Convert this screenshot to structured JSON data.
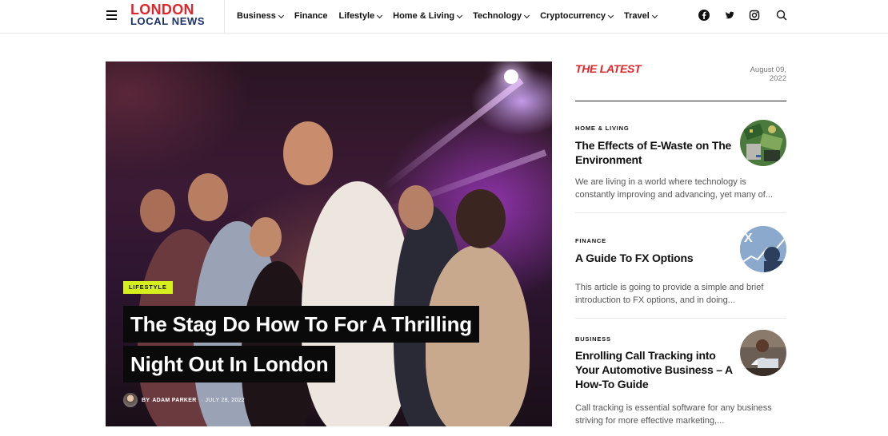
{
  "header": {
    "logo_top": "LONDON",
    "logo_bottom": "LOCAL NEWS",
    "nav": [
      {
        "label": "Business",
        "has_dropdown": true
      },
      {
        "label": "Finance",
        "has_dropdown": false
      },
      {
        "label": "Lifestyle",
        "has_dropdown": true
      },
      {
        "label": "Home & Living",
        "has_dropdown": true
      },
      {
        "label": "Technology",
        "has_dropdown": true
      },
      {
        "label": "Cryptocurrency",
        "has_dropdown": true
      },
      {
        "label": "Travel",
        "has_dropdown": true
      }
    ],
    "social_icons": [
      "facebook-icon",
      "twitter-icon",
      "instagram-icon"
    ],
    "search_icon": "search-icon",
    "menu_icon": "hamburger-menu-icon"
  },
  "hero": {
    "category": "LIFESTYLE",
    "title_line1": "The Stag Do How To For A Thrilling",
    "title_line2": "Night Out In London",
    "by": "BY",
    "author": "ADAM PARKER",
    "date": "JULY 28, 2022"
  },
  "latest": {
    "heading": "THE LATEST",
    "date": "August 09, 2022",
    "posts": [
      {
        "category": "HOME & LIVING",
        "title": "The Effects of E-Waste on The Environment",
        "excerpt": "We are living in a world where technology is constantly improving and advancing, yet many of..."
      },
      {
        "category": "FINANCE",
        "title": "A Guide To FX Options",
        "excerpt": "This article is going to provide a simple and brief introduction to FX options, and in doing..."
      },
      {
        "category": "BUSINESS",
        "title": "Enrolling Call Tracking into Your Automotive Business – A How-To Guide",
        "excerpt": "Call tracking is essential software for any business striving for more effective marketing,..."
      }
    ]
  },
  "colors": {
    "brand_red": "#e0262b",
    "brand_navy": "#1b2f6b",
    "accent_lime": "#d6f01d",
    "text_dark": "#111111",
    "text_muted": "#555555"
  }
}
